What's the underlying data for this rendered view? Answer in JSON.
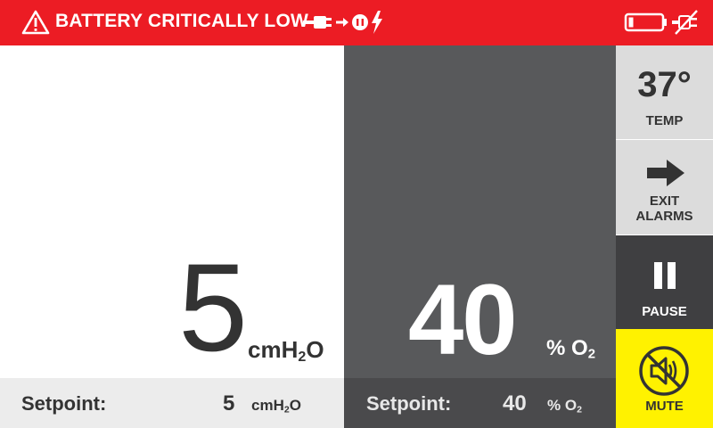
{
  "alarm": {
    "message": "BATTERY CRITICALLY LOW",
    "background": "#ec1c24",
    "icons": [
      "warning-triangle-icon",
      "plug-to-outlet-charging-icon",
      "battery-empty-icon",
      "unplugged-icon"
    ]
  },
  "pressure": {
    "value": "5",
    "unit_main": "cmH",
    "unit_sub": "2",
    "unit_tail": "O",
    "setpoint_label": "Setpoint:",
    "setpoint_value": "5",
    "setpoint_unit_main": "cmH",
    "setpoint_unit_sub": "2",
    "setpoint_unit_tail": "O"
  },
  "oxygen": {
    "value": "40",
    "unit_main": "% O",
    "unit_sub": "2",
    "setpoint_label": "Setpoint:",
    "setpoint_value": "40",
    "setpoint_unit_main": "% O",
    "setpoint_unit_sub": "2"
  },
  "buttons": {
    "temp": {
      "value": "37°",
      "label": "TEMP"
    },
    "exit_alarms": {
      "line1": "EXIT",
      "line2": "ALARMS",
      "icon": "arrow-right-icon"
    },
    "pause": {
      "label": "PAUSE",
      "icon": "pause-icon"
    },
    "mute": {
      "label": "MUTE",
      "icon": "speaker-muted-icon"
    }
  },
  "colors": {
    "alarm_red": "#ec1c24",
    "oxygen_panel": "#58595b",
    "mute_yellow": "#fff200",
    "pause_dark": "#3f3f41"
  }
}
